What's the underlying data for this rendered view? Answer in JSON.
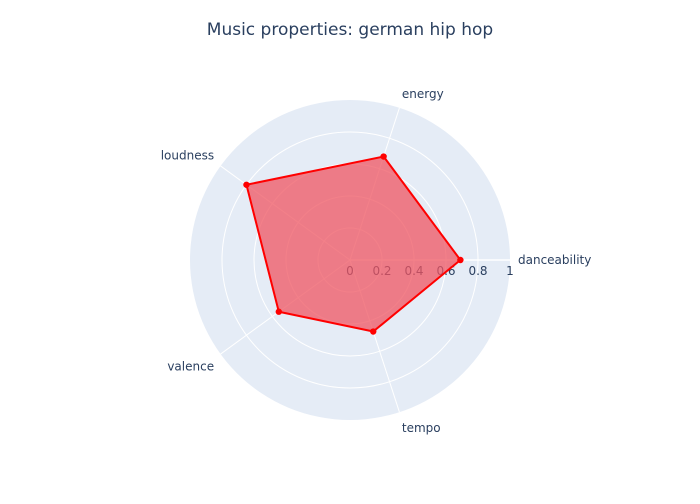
{
  "chart_data": {
    "type": "radar",
    "title": "Music properties: german hip hop",
    "categories": [
      "danceability",
      "energy",
      "loudness",
      "valence",
      "tempo"
    ],
    "series": [
      {
        "name": "",
        "values": [
          0.69,
          0.68,
          0.8,
          0.55,
          0.47
        ],
        "color": "#ff0000",
        "fill_color": "rgba(239, 85, 97, 0.75)"
      }
    ],
    "radial_ticks": [
      "0",
      "0.2",
      "0.4",
      "0.6",
      "0.8",
      "1"
    ],
    "radial_range": [
      0,
      1
    ],
    "background_color": "#e5ecf6",
    "grid_color": "#ffffff",
    "grid": true
  }
}
